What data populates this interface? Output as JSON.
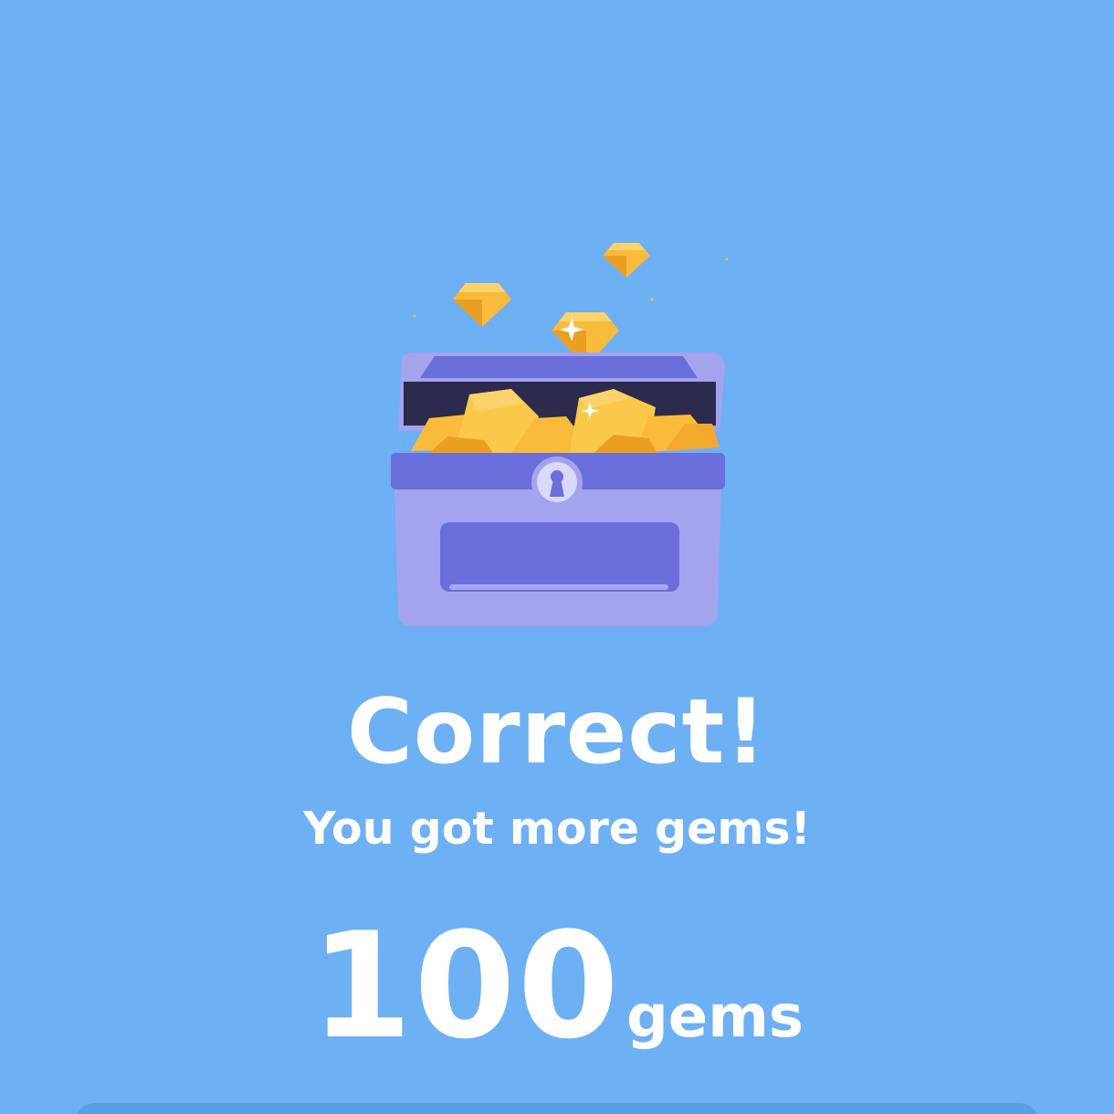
{
  "screen": {
    "background_color": "#6db0f4"
  },
  "illustration": {
    "name": "treasure-chest-with-gems",
    "gem_color": "#f9bb3b",
    "chest_color": "#a4a3ee",
    "chest_band_color": "#6b6fdb"
  },
  "result": {
    "title": "Correct!",
    "subtitle": "You got more gems!"
  },
  "reward": {
    "amount": "100",
    "unit": "gems"
  }
}
